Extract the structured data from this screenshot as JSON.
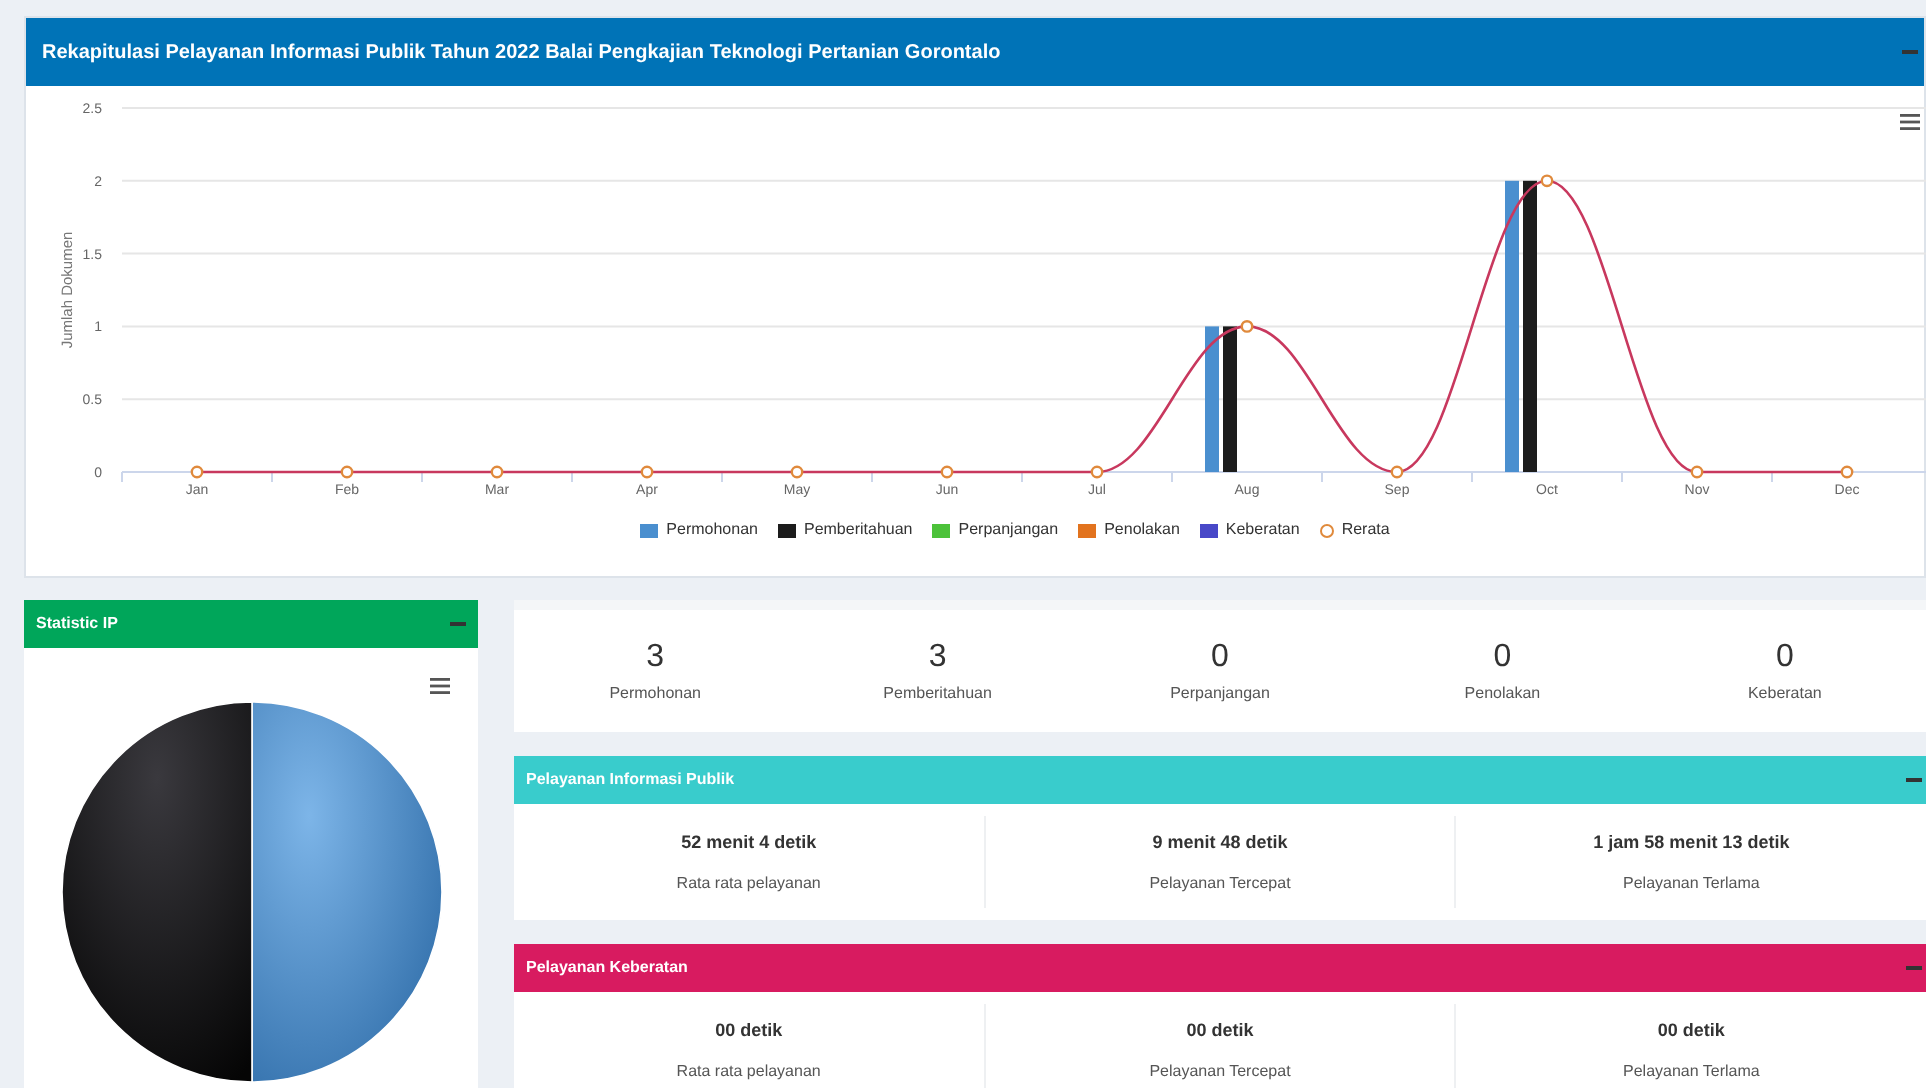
{
  "header": {
    "title": "Rekapitulasi Pelayanan Informasi Publik Tahun 2022 Balai Pengkajian Teknologi Pertanian Gorontalo"
  },
  "chart": {
    "chart_data": {
      "type": "bar",
      "ylabel": "Jumlah Dokumen",
      "categories": [
        "Jan",
        "Feb",
        "Mar",
        "Apr",
        "May",
        "Jun",
        "Jul",
        "Aug",
        "Sep",
        "Oct",
        "Nov",
        "Dec"
      ],
      "ylim": [
        0,
        2.5
      ],
      "grid": true,
      "legend": "bottom",
      "yticks": [
        0,
        0.5,
        1,
        1.5,
        2,
        2.5
      ],
      "series": [
        {
          "name": "Permohonan",
          "color": "#4a8fcf",
          "type": "bar",
          "values": [
            0,
            0,
            0,
            0,
            0,
            0,
            0,
            1,
            0,
            2,
            0,
            0
          ]
        },
        {
          "name": "Pemberitahuan",
          "color": "#1c1c1c",
          "type": "bar",
          "values": [
            0,
            0,
            0,
            0,
            0,
            0,
            0,
            1,
            0,
            2,
            0,
            0
          ]
        },
        {
          "name": "Perpanjangan",
          "color": "#4cc23a",
          "type": "bar",
          "values": [
            0,
            0,
            0,
            0,
            0,
            0,
            0,
            0,
            0,
            0,
            0,
            0
          ]
        },
        {
          "name": "Penolakan",
          "color": "#e2731e",
          "type": "bar",
          "values": [
            0,
            0,
            0,
            0,
            0,
            0,
            0,
            0,
            0,
            0,
            0,
            0
          ]
        },
        {
          "name": "Keberatan",
          "color": "#4848c8",
          "type": "bar",
          "values": [
            0,
            0,
            0,
            0,
            0,
            0,
            0,
            0,
            0,
            0,
            0,
            0
          ]
        },
        {
          "name": "Rerata",
          "color": "#c8385e",
          "type": "line",
          "marker": "circle",
          "values": [
            0,
            0,
            0,
            0,
            0,
            0,
            0,
            1,
            0,
            2,
            0,
            0
          ]
        }
      ]
    }
  },
  "statistic_ip": {
    "title": "Statistic IP"
  },
  "stats": [
    {
      "value": "3",
      "label": "Permohonan"
    },
    {
      "value": "3",
      "label": "Pemberitahuan"
    },
    {
      "value": "0",
      "label": "Perpanjangan"
    },
    {
      "value": "0",
      "label": "Penolakan"
    },
    {
      "value": "0",
      "label": "Keberatan"
    }
  ],
  "panels": [
    {
      "title": "Pelayanan Informasi Publik",
      "color": "#39cccc",
      "items": [
        {
          "value": "52 menit 4 detik",
          "label": "Rata rata pelayanan"
        },
        {
          "value": "9 menit 48 detik",
          "label": "Pelayanan Tercepat"
        },
        {
          "value": "1 jam 58 menit 13 detik",
          "label": "Pelayanan Terlama"
        }
      ]
    },
    {
      "title": "Pelayanan Keberatan",
      "color": "#d81b60",
      "items": [
        {
          "value": "00 detik",
          "label": "Rata rata pelayanan"
        },
        {
          "value": "00 detik",
          "label": "Pelayanan Tercepat"
        },
        {
          "value": "00 detik",
          "label": "Pelayanan Terlama"
        }
      ]
    }
  ]
}
